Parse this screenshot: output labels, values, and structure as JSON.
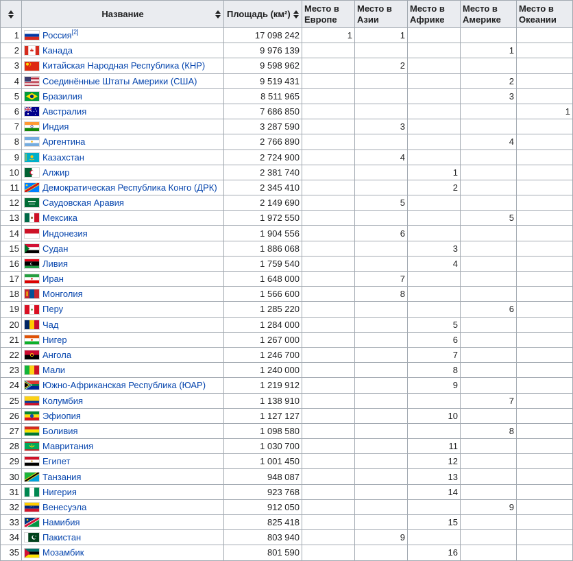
{
  "colors": {
    "link": "#0645ad",
    "header_bg": "#eaecf0",
    "border": "#a2a9b1"
  },
  "headers": {
    "num": "",
    "name": "Название",
    "area": "Площадь (км²)",
    "europe": "Место в Европе",
    "asia": "Место в Азии",
    "africa": "Место в Африке",
    "america": "Место в Америке",
    "oceania": "Место в Океании"
  },
  "rows": [
    {
      "n": "1",
      "name": "Россия",
      "ref": "[2]",
      "flag": "RU",
      "area": "17 098 242",
      "eu": "1",
      "as": "1",
      "af": "",
      "am": "",
      "oc": ""
    },
    {
      "n": "2",
      "name": "Канада",
      "ref": "",
      "flag": "CA",
      "area": "9 976 139",
      "eu": "",
      "as": "",
      "af": "",
      "am": "1",
      "oc": ""
    },
    {
      "n": "3",
      "name": "Китайская Народная Республика (КНР)",
      "ref": "",
      "flag": "CN",
      "area": "9 598 962",
      "eu": "",
      "as": "2",
      "af": "",
      "am": "",
      "oc": ""
    },
    {
      "n": "4",
      "name": "Соединённые Штаты Америки (США)",
      "ref": "",
      "flag": "US",
      "area": "9 519 431",
      "eu": "",
      "as": "",
      "af": "",
      "am": "2",
      "oc": ""
    },
    {
      "n": "5",
      "name": "Бразилия",
      "ref": "",
      "flag": "BR",
      "area": "8 511 965",
      "eu": "",
      "as": "",
      "af": "",
      "am": "3",
      "oc": ""
    },
    {
      "n": "6",
      "name": "Австралия",
      "ref": "",
      "flag": "AU",
      "area": "7 686 850",
      "eu": "",
      "as": "",
      "af": "",
      "am": "",
      "oc": "1"
    },
    {
      "n": "7",
      "name": "Индия",
      "ref": "",
      "flag": "IN",
      "area": "3 287 590",
      "eu": "",
      "as": "3",
      "af": "",
      "am": "",
      "oc": ""
    },
    {
      "n": "8",
      "name": "Аргентина",
      "ref": "",
      "flag": "AR",
      "area": "2 766 890",
      "eu": "",
      "as": "",
      "af": "",
      "am": "4",
      "oc": ""
    },
    {
      "n": "9",
      "name": "Казахстан",
      "ref": "",
      "flag": "KZ",
      "area": "2 724 900",
      "eu": "",
      "as": "4",
      "af": "",
      "am": "",
      "oc": ""
    },
    {
      "n": "10",
      "name": "Алжир",
      "ref": "",
      "flag": "DZ",
      "area": "2 381 740",
      "eu": "",
      "as": "",
      "af": "1",
      "am": "",
      "oc": ""
    },
    {
      "n": "11",
      "name": "Демократическая Республика Конго (ДРК)",
      "ref": "",
      "flag": "CD",
      "area": "2 345 410",
      "eu": "",
      "as": "",
      "af": "2",
      "am": "",
      "oc": ""
    },
    {
      "n": "12",
      "name": "Саудовская Аравия",
      "ref": "",
      "flag": "SA",
      "area": "2 149 690",
      "eu": "",
      "as": "5",
      "af": "",
      "am": "",
      "oc": ""
    },
    {
      "n": "13",
      "name": "Мексика",
      "ref": "",
      "flag": "MX",
      "area": "1 972 550",
      "eu": "",
      "as": "",
      "af": "",
      "am": "5",
      "oc": ""
    },
    {
      "n": "14",
      "name": "Индонезия",
      "ref": "",
      "flag": "ID",
      "area": "1 904 556",
      "eu": "",
      "as": "6",
      "af": "",
      "am": "",
      "oc": ""
    },
    {
      "n": "15",
      "name": "Судан",
      "ref": "",
      "flag": "SD",
      "area": "1 886 068",
      "eu": "",
      "as": "",
      "af": "3",
      "am": "",
      "oc": ""
    },
    {
      "n": "16",
      "name": "Ливия",
      "ref": "",
      "flag": "LY",
      "area": "1 759 540",
      "eu": "",
      "as": "",
      "af": "4",
      "am": "",
      "oc": ""
    },
    {
      "n": "17",
      "name": "Иран",
      "ref": "",
      "flag": "IR",
      "area": "1 648 000",
      "eu": "",
      "as": "7",
      "af": "",
      "am": "",
      "oc": ""
    },
    {
      "n": "18",
      "name": "Монголия",
      "ref": "",
      "flag": "MN",
      "area": "1 566 600",
      "eu": "",
      "as": "8",
      "af": "",
      "am": "",
      "oc": ""
    },
    {
      "n": "19",
      "name": "Перу",
      "ref": "",
      "flag": "PE",
      "area": "1 285 220",
      "eu": "",
      "as": "",
      "af": "",
      "am": "6",
      "oc": ""
    },
    {
      "n": "20",
      "name": "Чад",
      "ref": "",
      "flag": "TD",
      "area": "1 284 000",
      "eu": "",
      "as": "",
      "af": "5",
      "am": "",
      "oc": ""
    },
    {
      "n": "21",
      "name": "Нигер",
      "ref": "",
      "flag": "NE",
      "area": "1 267 000",
      "eu": "",
      "as": "",
      "af": "6",
      "am": "",
      "oc": ""
    },
    {
      "n": "22",
      "name": "Ангола",
      "ref": "",
      "flag": "AO",
      "area": "1 246 700",
      "eu": "",
      "as": "",
      "af": "7",
      "am": "",
      "oc": ""
    },
    {
      "n": "23",
      "name": "Мали",
      "ref": "",
      "flag": "ML",
      "area": "1 240 000",
      "eu": "",
      "as": "",
      "af": "8",
      "am": "",
      "oc": ""
    },
    {
      "n": "24",
      "name": "Южно-Африканская Республика (ЮАР)",
      "ref": "",
      "flag": "ZA",
      "area": "1 219 912",
      "eu": "",
      "as": "",
      "af": "9",
      "am": "",
      "oc": ""
    },
    {
      "n": "25",
      "name": "Колумбия",
      "ref": "",
      "flag": "CO",
      "area": "1 138 910",
      "eu": "",
      "as": "",
      "af": "",
      "am": "7",
      "oc": ""
    },
    {
      "n": "26",
      "name": "Эфиопия",
      "ref": "",
      "flag": "ET",
      "area": "1 127 127",
      "eu": "",
      "as": "",
      "af": "10",
      "am": "",
      "oc": ""
    },
    {
      "n": "27",
      "name": "Боливия",
      "ref": "",
      "flag": "BO",
      "area": "1 098 580",
      "eu": "",
      "as": "",
      "af": "",
      "am": "8",
      "oc": ""
    },
    {
      "n": "28",
      "name": "Мавритания",
      "ref": "",
      "flag": "MR",
      "area": "1 030 700",
      "eu": "",
      "as": "",
      "af": "11",
      "am": "",
      "oc": ""
    },
    {
      "n": "29",
      "name": "Египет",
      "ref": "",
      "flag": "EG",
      "area": "1 001 450",
      "eu": "",
      "as": "",
      "af": "12",
      "am": "",
      "oc": ""
    },
    {
      "n": "30",
      "name": "Танзания",
      "ref": "",
      "flag": "TZ",
      "area": "948 087",
      "eu": "",
      "as": "",
      "af": "13",
      "am": "",
      "oc": ""
    },
    {
      "n": "31",
      "name": "Нигерия",
      "ref": "",
      "flag": "NG",
      "area": "923 768",
      "eu": "",
      "as": "",
      "af": "14",
      "am": "",
      "oc": ""
    },
    {
      "n": "32",
      "name": "Венесуэла",
      "ref": "",
      "flag": "VE",
      "area": "912 050",
      "eu": "",
      "as": "",
      "af": "",
      "am": "9",
      "oc": ""
    },
    {
      "n": "33",
      "name": "Намибия",
      "ref": "",
      "flag": "NA",
      "area": "825 418",
      "eu": "",
      "as": "",
      "af": "15",
      "am": "",
      "oc": ""
    },
    {
      "n": "34",
      "name": "Пакистан",
      "ref": "",
      "flag": "PK",
      "area": "803 940",
      "eu": "",
      "as": "9",
      "af": "",
      "am": "",
      "oc": ""
    },
    {
      "n": "35",
      "name": "Мозамбик",
      "ref": "",
      "flag": "MZ",
      "area": "801 590",
      "eu": "",
      "as": "",
      "af": "16",
      "am": "",
      "oc": ""
    }
  ]
}
